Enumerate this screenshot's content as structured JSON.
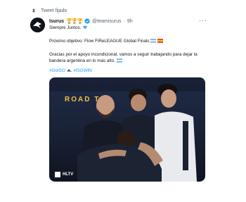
{
  "tweet": {
    "pinned_label": "Tweet fijado",
    "author_name": "Isurus",
    "author_handle": "@teamisurus",
    "time": "9h",
    "line1": "Siempre Juntos.",
    "line2": "Próximo objetivo: Flow FiReLEAGUE Global Finals",
    "line3": "Gracias por el apoyo incondicional, vamos a seguir trabajando para dejar la bandera argentina en lo más alto.",
    "hashtag1": "#GoISG",
    "hashtag2": "#ISGWIN",
    "more_label": "···"
  },
  "media": {
    "backdrop_text": "ROAD TO",
    "watermark": "HLTV"
  },
  "colors": {
    "accent": "#1d9bf0",
    "muted": "#536471",
    "text": "#0f1419"
  }
}
